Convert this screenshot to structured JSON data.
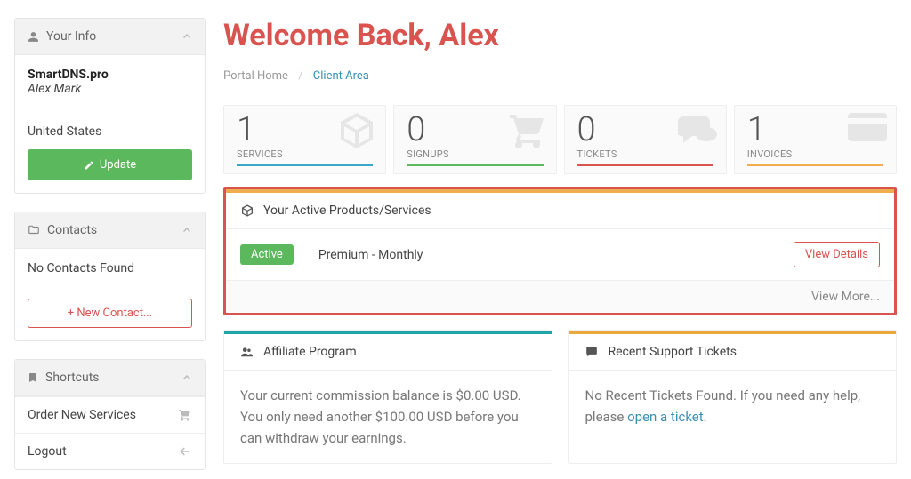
{
  "sidebar": {
    "info": {
      "title": "Your Info",
      "brand": "SmartDNS.pro",
      "name": "Alex Mark",
      "country": "United States",
      "update_label": "Update"
    },
    "contacts": {
      "title": "Contacts",
      "empty": "No Contacts Found",
      "new_label": "+ New Contact..."
    },
    "shortcuts": {
      "title": "Shortcuts",
      "order": "Order New Services",
      "logout": "Logout"
    }
  },
  "header": {
    "title": "Welcome Back, Alex",
    "crumb_home": "Portal Home",
    "crumb_current": "Client Area"
  },
  "stats": {
    "services": {
      "value": "1",
      "label": "SERVICES"
    },
    "signups": {
      "value": "0",
      "label": "SIGNUPS"
    },
    "tickets": {
      "value": "0",
      "label": "TICKETS"
    },
    "invoices": {
      "value": "1",
      "label": "INVOICES"
    }
  },
  "products": {
    "title": "Your Active Products/Services",
    "badge": "Active",
    "name": "Premium - Monthly",
    "details_label": "View Details",
    "more_label": "View More..."
  },
  "affiliate": {
    "title": "Affiliate Program",
    "body": "Your current commission balance is $0.00 USD. You only need another $100.00 USD before you can withdraw your earnings."
  },
  "tickets": {
    "title": "Recent Support Tickets",
    "body_pre": "No Recent Tickets Found. If you need any help, please ",
    "link": "open a ticket",
    "body_post": "."
  }
}
